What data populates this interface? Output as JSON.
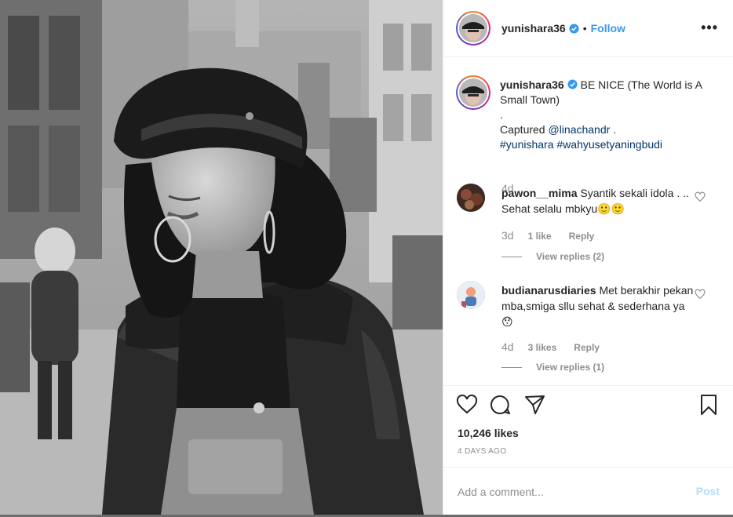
{
  "header": {
    "username": "yunishara36",
    "separator": "•",
    "follow_label": "Follow",
    "more_label": "•••"
  },
  "caption": {
    "username": "yunishara36",
    "line1": "BE NICE (The World is A Small Town)",
    "line2": ".",
    "captured_prefix": "Captured",
    "mention": "@linachandr",
    "captured_suffix": ".",
    "hashtag1": "#yunishara",
    "hashtag2": "#wahyusetyaningbudi",
    "time": "4d"
  },
  "comments": [
    {
      "username": "pawon__mima",
      "text": "Syantik sekali idola . .. Sehat selalu mbkyu🙂🙂",
      "time": "3d",
      "likes": "1 like",
      "reply_label": "Reply",
      "view_replies": "View replies (2)"
    },
    {
      "username": "budianarusdiaries",
      "text": "Met berakhir pekan mba,smiga sllu sehat & sederhana ya😯",
      "time": "4d",
      "likes": "3 likes",
      "reply_label": "Reply",
      "view_replies": "View replies (1)"
    }
  ],
  "actions": {
    "icons": [
      "heart-icon",
      "comment-icon",
      "share-icon",
      "bookmark-icon"
    ],
    "likes_count": "10,246 likes",
    "posted": "4 DAYS AGO"
  },
  "composer": {
    "placeholder": "Add a comment...",
    "post_label": "Post"
  },
  "colors": {
    "link": "#3897f0",
    "verified": "#3897f0",
    "muted": "#8e8e8e",
    "post_disabled": "#b2dffc"
  }
}
